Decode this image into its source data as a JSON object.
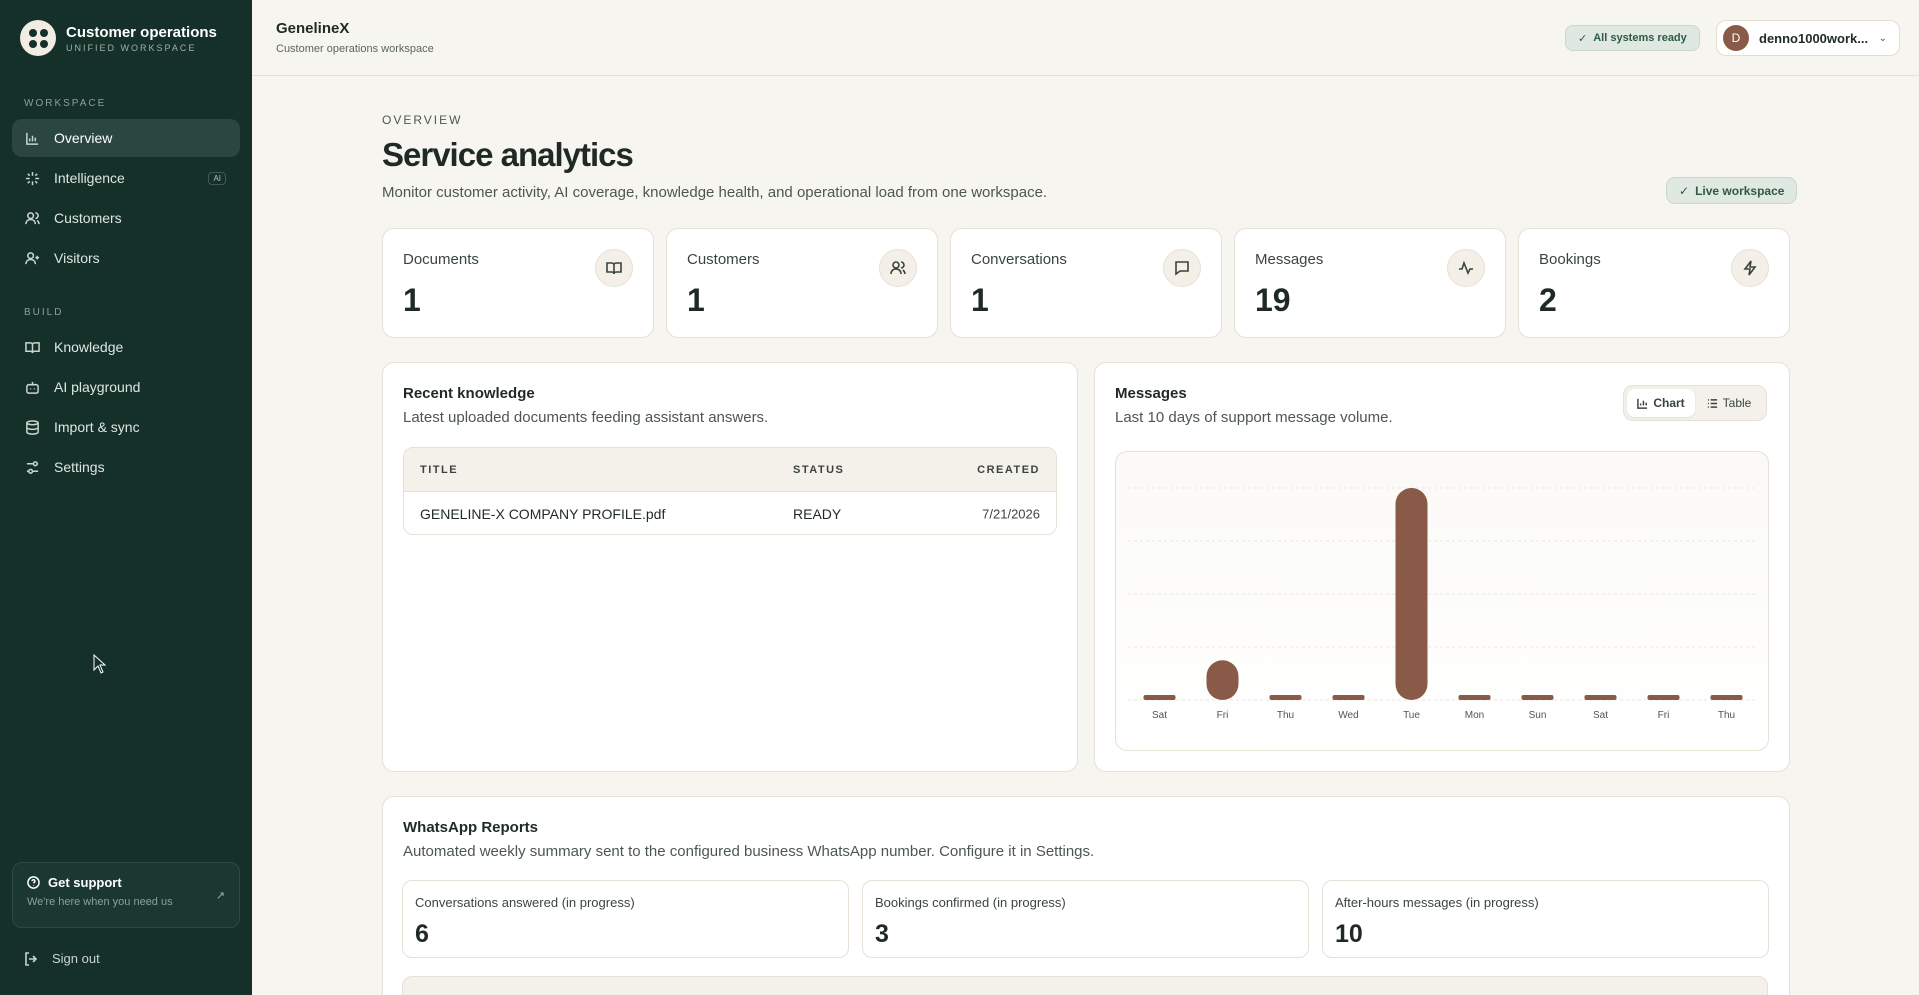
{
  "brand": {
    "title": "Customer operations",
    "subtitle": "UNIFIED WORKSPACE"
  },
  "sidebar": {
    "section_workspace": "WORKSPACE",
    "section_build": "BUILD",
    "items": [
      {
        "label": "Overview"
      },
      {
        "label": "Intelligence",
        "badge": "AI"
      },
      {
        "label": "Customers"
      },
      {
        "label": "Visitors"
      },
      {
        "label": "Knowledge"
      },
      {
        "label": "AI playground"
      },
      {
        "label": "Import & sync"
      },
      {
        "label": "Settings"
      }
    ],
    "support": {
      "title": "Get support",
      "subtitle": "We're here when you need us"
    },
    "signout": "Sign out"
  },
  "topbar": {
    "title": "GenelineX",
    "subtitle": "Customer operations workspace",
    "status": "All systems ready",
    "user": {
      "initial": "D",
      "name": "denno1000work..."
    }
  },
  "main": {
    "eyebrow": "OVERVIEW",
    "title": "Service analytics",
    "subtitle": "Monitor customer activity, AI coverage, knowledge health, and operational load from one workspace.",
    "live": "Live workspace"
  },
  "stats": [
    {
      "label": "Documents",
      "value": "1",
      "icon": "book-icon"
    },
    {
      "label": "Customers",
      "value": "1",
      "icon": "users-icon"
    },
    {
      "label": "Conversations",
      "value": "1",
      "icon": "chat-icon"
    },
    {
      "label": "Messages",
      "value": "19",
      "icon": "activity-icon"
    },
    {
      "label": "Bookings",
      "value": "2",
      "icon": "bolt-icon"
    }
  ],
  "knowledge": {
    "title": "Recent knowledge",
    "subtitle": "Latest uploaded documents feeding assistant answers.",
    "columns": [
      "TITLE",
      "STATUS",
      "CREATED"
    ],
    "rows": [
      {
        "title": "GENELINE-X COMPANY PROFILE.pdf",
        "status": "READY",
        "created": "7/21/2026"
      }
    ]
  },
  "messages_panel": {
    "title": "Messages",
    "subtitle": "Last 10 days of support message volume.",
    "toggle_chart": "Chart",
    "toggle_table": "Table"
  },
  "chart_data": {
    "type": "bar",
    "categories": [
      "Sat",
      "Fri",
      "Thu",
      "Wed",
      "Tue",
      "Mon",
      "Sun",
      "Sat",
      "Fri",
      "Thu"
    ],
    "values": [
      0,
      3,
      0,
      0,
      16,
      0,
      0,
      0,
      0,
      0
    ],
    "title": "",
    "xlabel": "",
    "ylabel": "",
    "ylim": [
      0,
      16
    ],
    "grid": true,
    "color": "#8a5a48"
  },
  "whatsapp": {
    "title": "WhatsApp Reports",
    "subtitle": "Automated weekly summary sent to the configured business WhatsApp number. Configure it in Settings.",
    "cards": [
      {
        "label": "Conversations answered (in progress)",
        "value": "6"
      },
      {
        "label": "Bookings confirmed (in progress)",
        "value": "3"
      },
      {
        "label": "After-hours messages (in progress)",
        "value": "10"
      }
    ]
  }
}
